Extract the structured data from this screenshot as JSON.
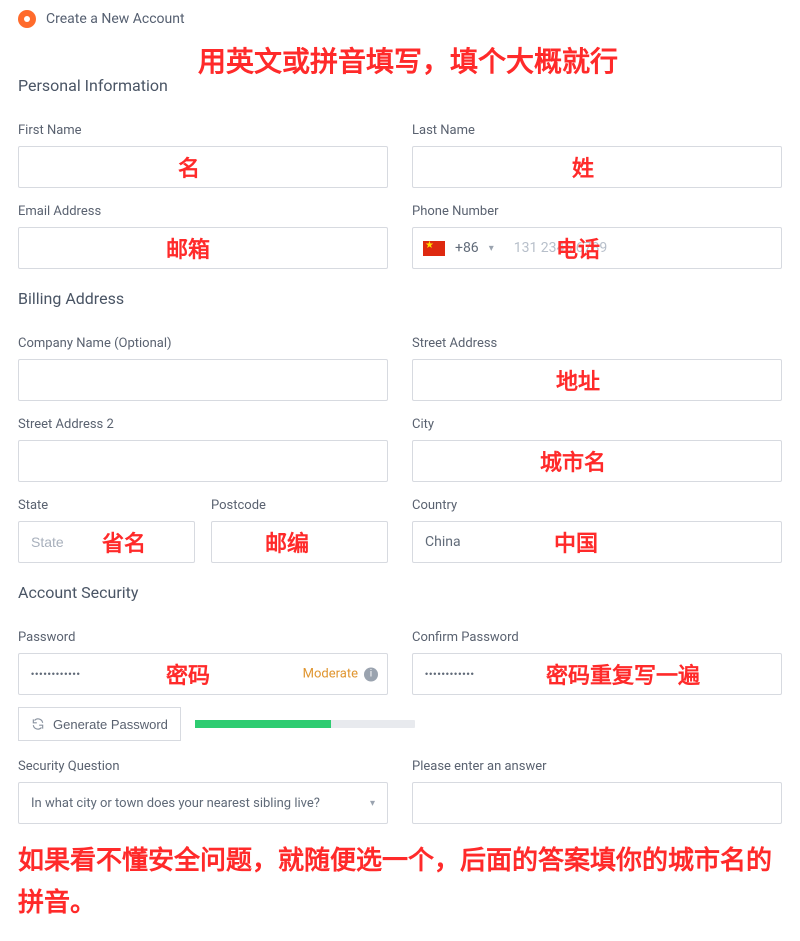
{
  "header": {
    "title": "Create a New Account"
  },
  "annotations": {
    "top_instruction": "用英文或拼音填写，填个大概就行",
    "first_name": "名",
    "last_name": "姓",
    "email": "邮箱",
    "phone": "电话",
    "street": "地址",
    "city": "城市名",
    "state": "省名",
    "postcode": "邮编",
    "country": "中国",
    "password": "密码",
    "confirm_password": "密码重复写一遍",
    "footer": "如果看不懂安全问题，就随便选一个，后面的答案填你的城市名的拼音。"
  },
  "personal": {
    "section": "Personal Information",
    "first_name_label": "First Name",
    "first_name_value": "",
    "last_name_label": "Last Name",
    "last_name_value": "",
    "email_label": "Email Address",
    "email_value": "",
    "phone_label": "Phone Number",
    "phone_dial": "+86",
    "phone_value": "131 2345 6789"
  },
  "billing": {
    "section": "Billing Address",
    "company_label": "Company Name (Optional)",
    "company_value": "",
    "street1_label": "Street Address",
    "street1_value": "",
    "street2_label": "Street Address 2",
    "street2_value": "",
    "city_label": "City",
    "city_value": "",
    "state_label": "State",
    "state_placeholder": "State",
    "postcode_label": "Postcode",
    "postcode_value": "",
    "country_label": "Country",
    "country_value": "China"
  },
  "security": {
    "section": "Account Security",
    "password_label": "Password",
    "password_value": "••••••••••••",
    "password_strength_text": "Moderate",
    "password_strength_pct": 62,
    "confirm_label": "Confirm Password",
    "confirm_value": "••••••••••••",
    "generate_btn": "Generate Password",
    "question_label": "Security Question",
    "question_value": "In what city or town does your nearest sibling live?",
    "answer_label": "Please enter an answer",
    "answer_value": ""
  }
}
